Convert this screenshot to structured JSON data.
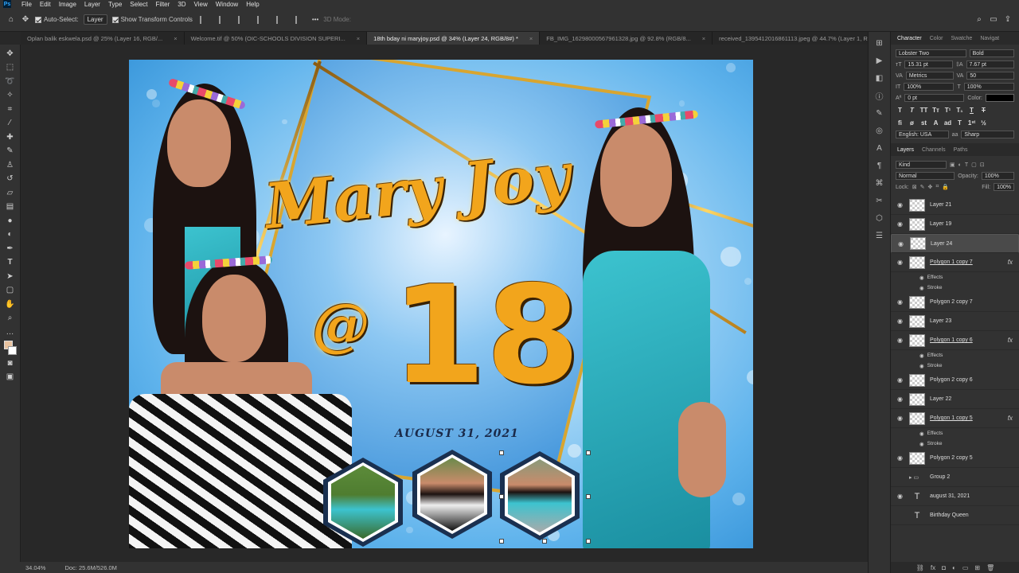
{
  "menu": [
    "File",
    "Edit",
    "Image",
    "Layer",
    "Type",
    "Select",
    "Filter",
    "3D",
    "View",
    "Window",
    "Help"
  ],
  "app_logo": "Ps",
  "options": {
    "auto_select_label": "Auto-Select:",
    "auto_select_value": "Layer",
    "transform_controls_label": "Show Transform Controls",
    "mode_3d_label": "3D Mode:"
  },
  "tabs": [
    {
      "label": "Oplan balik eskwela.psd @ 25% (Layer 16, RGB/...",
      "active": false
    },
    {
      "label": "Welcome.tif @ 50% (OIC-SCHOOLS DIVISION  SUPERI...",
      "active": false
    },
    {
      "label": "18th bday ni maryjoy.psd @ 34% (Layer 24, RGB/8#) *",
      "active": true
    },
    {
      "label": "FB_IMG_16298000567961328.jpg @ 92.8% (RGB/8...",
      "active": false
    },
    {
      "label": "received_1395412016861113.jpeg @ 44.7% (Layer 1, R...",
      "active": false
    }
  ],
  "poster": {
    "name": "Mary Joy",
    "age_line_at": "@",
    "age_line_num": "18",
    "date": "AUGUST 31, 2021"
  },
  "status": {
    "zoom": "34.04%",
    "doc": "Doc: 25.6M/526.0M"
  },
  "panel_tabs": {
    "character": "Character",
    "color": "Color",
    "swatches": "Swatche",
    "navigator": "Navigat"
  },
  "character": {
    "font_family": "Lobster Two",
    "font_style": "Bold",
    "font_size": "15.31 pt",
    "leading": "7.67 pt",
    "kerning": "Metrics",
    "tracking": "50",
    "vscale": "100%",
    "hscale": "100%",
    "baseline": "0 pt",
    "color_label": "Color:",
    "language": "English: USA",
    "antialias": "Sharp"
  },
  "layers_tabs": {
    "layers": "Layers",
    "channels": "Channels",
    "paths": "Paths"
  },
  "layers_ctrl": {
    "kind": "Kind",
    "blend": "Normal",
    "opacity_label": "Opacity:",
    "opacity": "100%",
    "lock_label": "Lock:",
    "fill_label": "Fill:",
    "fill": "100%"
  },
  "layers": [
    {
      "type": "layer",
      "name": "Layer 21",
      "selected": false
    },
    {
      "type": "layer",
      "name": "Layer 19",
      "selected": false
    },
    {
      "type": "layer",
      "name": "Layer 24",
      "selected": true
    },
    {
      "type": "layer",
      "name": "Polygon 1 copy 7",
      "selected": false,
      "fx": true
    },
    {
      "type": "sub",
      "name": "Effects"
    },
    {
      "type": "sub",
      "name": "Stroke"
    },
    {
      "type": "layer",
      "name": "Polygon 2 copy 7",
      "selected": false
    },
    {
      "type": "layer",
      "name": "Layer 23",
      "selected": false
    },
    {
      "type": "layer",
      "name": "Polygon 1 copy 6",
      "selected": false,
      "fx": true
    },
    {
      "type": "sub",
      "name": "Effects"
    },
    {
      "type": "sub",
      "name": "Stroke"
    },
    {
      "type": "layer",
      "name": "Polygon 2 copy 6",
      "selected": false
    },
    {
      "type": "layer",
      "name": "Layer 22",
      "selected": false
    },
    {
      "type": "layer",
      "name": "Polygon 1 copy 5",
      "selected": false,
      "fx": true
    },
    {
      "type": "sub",
      "name": "Effects"
    },
    {
      "type": "sub",
      "name": "Stroke"
    },
    {
      "type": "layer",
      "name": "Polygon 2 copy 5",
      "selected": false
    },
    {
      "type": "group",
      "name": "Group 2",
      "selected": false
    },
    {
      "type": "text",
      "name": "august 31, 2021",
      "selected": false
    },
    {
      "type": "text",
      "name": "Birthday Queen",
      "selected": false
    }
  ],
  "fx_label": "fx",
  "colors": {
    "accent_gold": "#f2a51c",
    "sky": "#5fb3ec",
    "teal": "#3cc3cf"
  }
}
